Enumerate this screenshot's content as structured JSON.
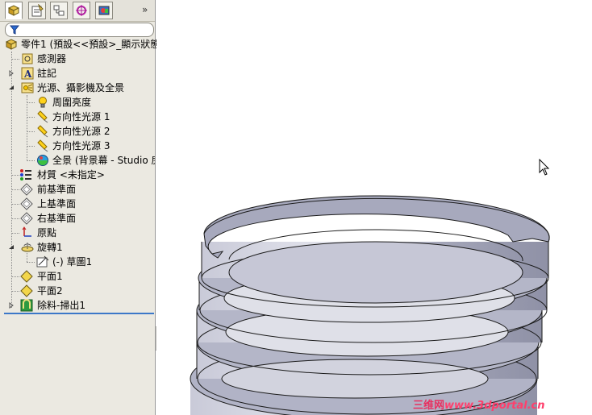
{
  "feature_manager": {
    "tabs": [
      {
        "id": "feature-tree",
        "icon": "feature-tree-icon",
        "active": true
      },
      {
        "id": "property-manager",
        "icon": "property-manager-icon",
        "active": false
      },
      {
        "id": "configuration-manager",
        "icon": "configuration-manager-icon",
        "active": false
      },
      {
        "id": "dimxpert-manager",
        "icon": "dimxpert-icon",
        "active": false
      },
      {
        "id": "display-manager",
        "icon": "display-manager-icon",
        "active": false
      }
    ],
    "more_glyph": "»",
    "tree": {
      "root": "零件1  (預設<<預設>_顯示狀態",
      "items": [
        {
          "label": "感測器",
          "icon": "sensors-icon"
        },
        {
          "label": "註記",
          "icon": "annotations-icon"
        },
        {
          "label": "光源、攝影機及全景",
          "icon": "lights-cameras-scene-icon"
        },
        {
          "label": "周圍亮度",
          "icon": "ambient-light-icon"
        },
        {
          "label": "方向性光源 1",
          "icon": "directional-light-icon"
        },
        {
          "label": "方向性光源 2",
          "icon": "directional-light-icon"
        },
        {
          "label": "方向性光源 3",
          "icon": "directional-light-icon"
        },
        {
          "label": "全景 (背景幕 - Studio 房F",
          "icon": "scene-icon"
        },
        {
          "label": "材質 <未指定>",
          "icon": "material-icon"
        },
        {
          "label": "前基準面",
          "icon": "plane-icon"
        },
        {
          "label": "上基準面",
          "icon": "plane-icon"
        },
        {
          "label": "右基準面",
          "icon": "plane-icon"
        },
        {
          "label": "原點",
          "icon": "origin-icon"
        },
        {
          "label": "旋轉1",
          "icon": "revolve-icon"
        },
        {
          "label": "(-) 草圖1",
          "icon": "sketch-icon"
        },
        {
          "label": "平面1",
          "icon": "plane-feature-icon"
        },
        {
          "label": "平面2",
          "icon": "plane-feature-icon"
        },
        {
          "label": "除料-掃出1",
          "icon": "swept-cut-icon"
        }
      ]
    }
  },
  "watermark": {
    "brand": "三维网",
    "url": "www.3dportal.cn"
  },
  "colors": {
    "panel_bg": "#ebe9e1",
    "selection_line": "#3c78c8",
    "model_face": "#a7a9bd",
    "watermark": "#e83060"
  }
}
